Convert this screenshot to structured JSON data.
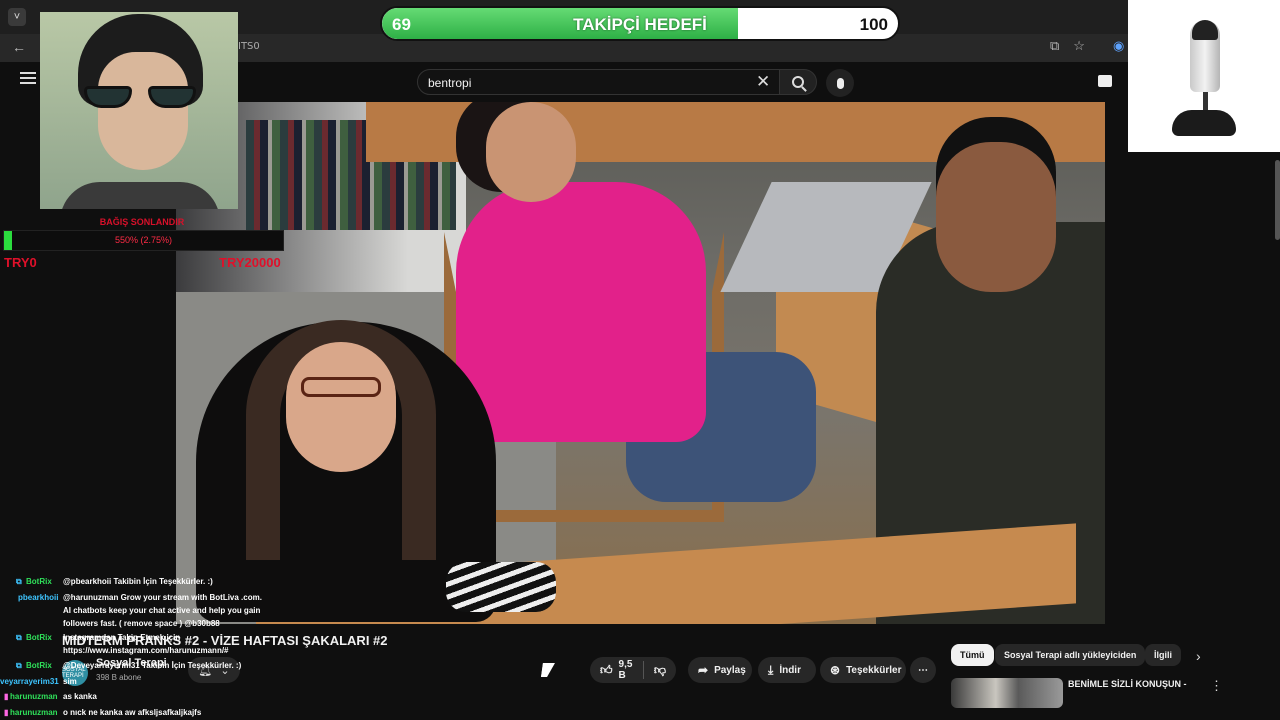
{
  "browser": {
    "tab_button": "˅",
    "url_fragment": "ITS0"
  },
  "search": {
    "value": "bentropi"
  },
  "follower_goal": {
    "current": "69",
    "label": "TAKİPÇİ HEDEFİ",
    "target": "100",
    "progress_fraction": 0.69,
    "fill_color": "#3cc852"
  },
  "donation_goal": {
    "title": "BAĞIŞ SONLANDIR",
    "percent_text": "550% (2.75%)",
    "progress_fraction": 0.0275,
    "min_label": "TRY0",
    "max_label": "TRY20000",
    "fill_color": "#2bdc3e",
    "text_color": "#e0102a"
  },
  "video": {
    "title": "MIDTERM PRANKS #2 - VİZE HAFTASI ŞAKALARI #2",
    "channel_name": "Sosyal Terapi",
    "channel_subs": "398 B abone",
    "avatar_text": "SOSYAL TERAPİ"
  },
  "actions": {
    "likes": "9,5 B",
    "share": "Paylaş",
    "download": "İndir",
    "thanks": "Teşekkürler",
    "more": "⋯"
  },
  "chips": {
    "all": "Tümü",
    "uploader": "Sosyal Terapi adlı yükleyiciden",
    "related": "İlgili"
  },
  "recommendation": {
    "title": "BENİMLE SİZLİ KONUŞUN -"
  },
  "chat": [
    {
      "user": "BotRix",
      "message": "@pbearkhoii Takibin İçin Teşekkürler. :)"
    },
    {
      "user": "pbearkhoii",
      "message_lines": [
        "@harunuzman Grow your stream with BotLiva .com.",
        "AI chatbots keep your chat active and help you gain",
        "followers fast. ( remove space ) @b30b88"
      ]
    },
    {
      "user": "BotRix",
      "message_lines": [
        "Instagramdan Takip Etmek için",
        "https://www.instagram.com/harunuzmann/#"
      ]
    },
    {
      "user": "BotRix",
      "message": "@Deveyarrayerim31 Takibin İçin Teşekkürler. :)"
    },
    {
      "user": "veyarrayerim31",
      "message": "sim"
    },
    {
      "user": "harunuzman",
      "message": "as kanka"
    },
    {
      "user": "harunuzman",
      "message": "o nıck ne kanka aw afksljsafkaljkajfs"
    }
  ]
}
